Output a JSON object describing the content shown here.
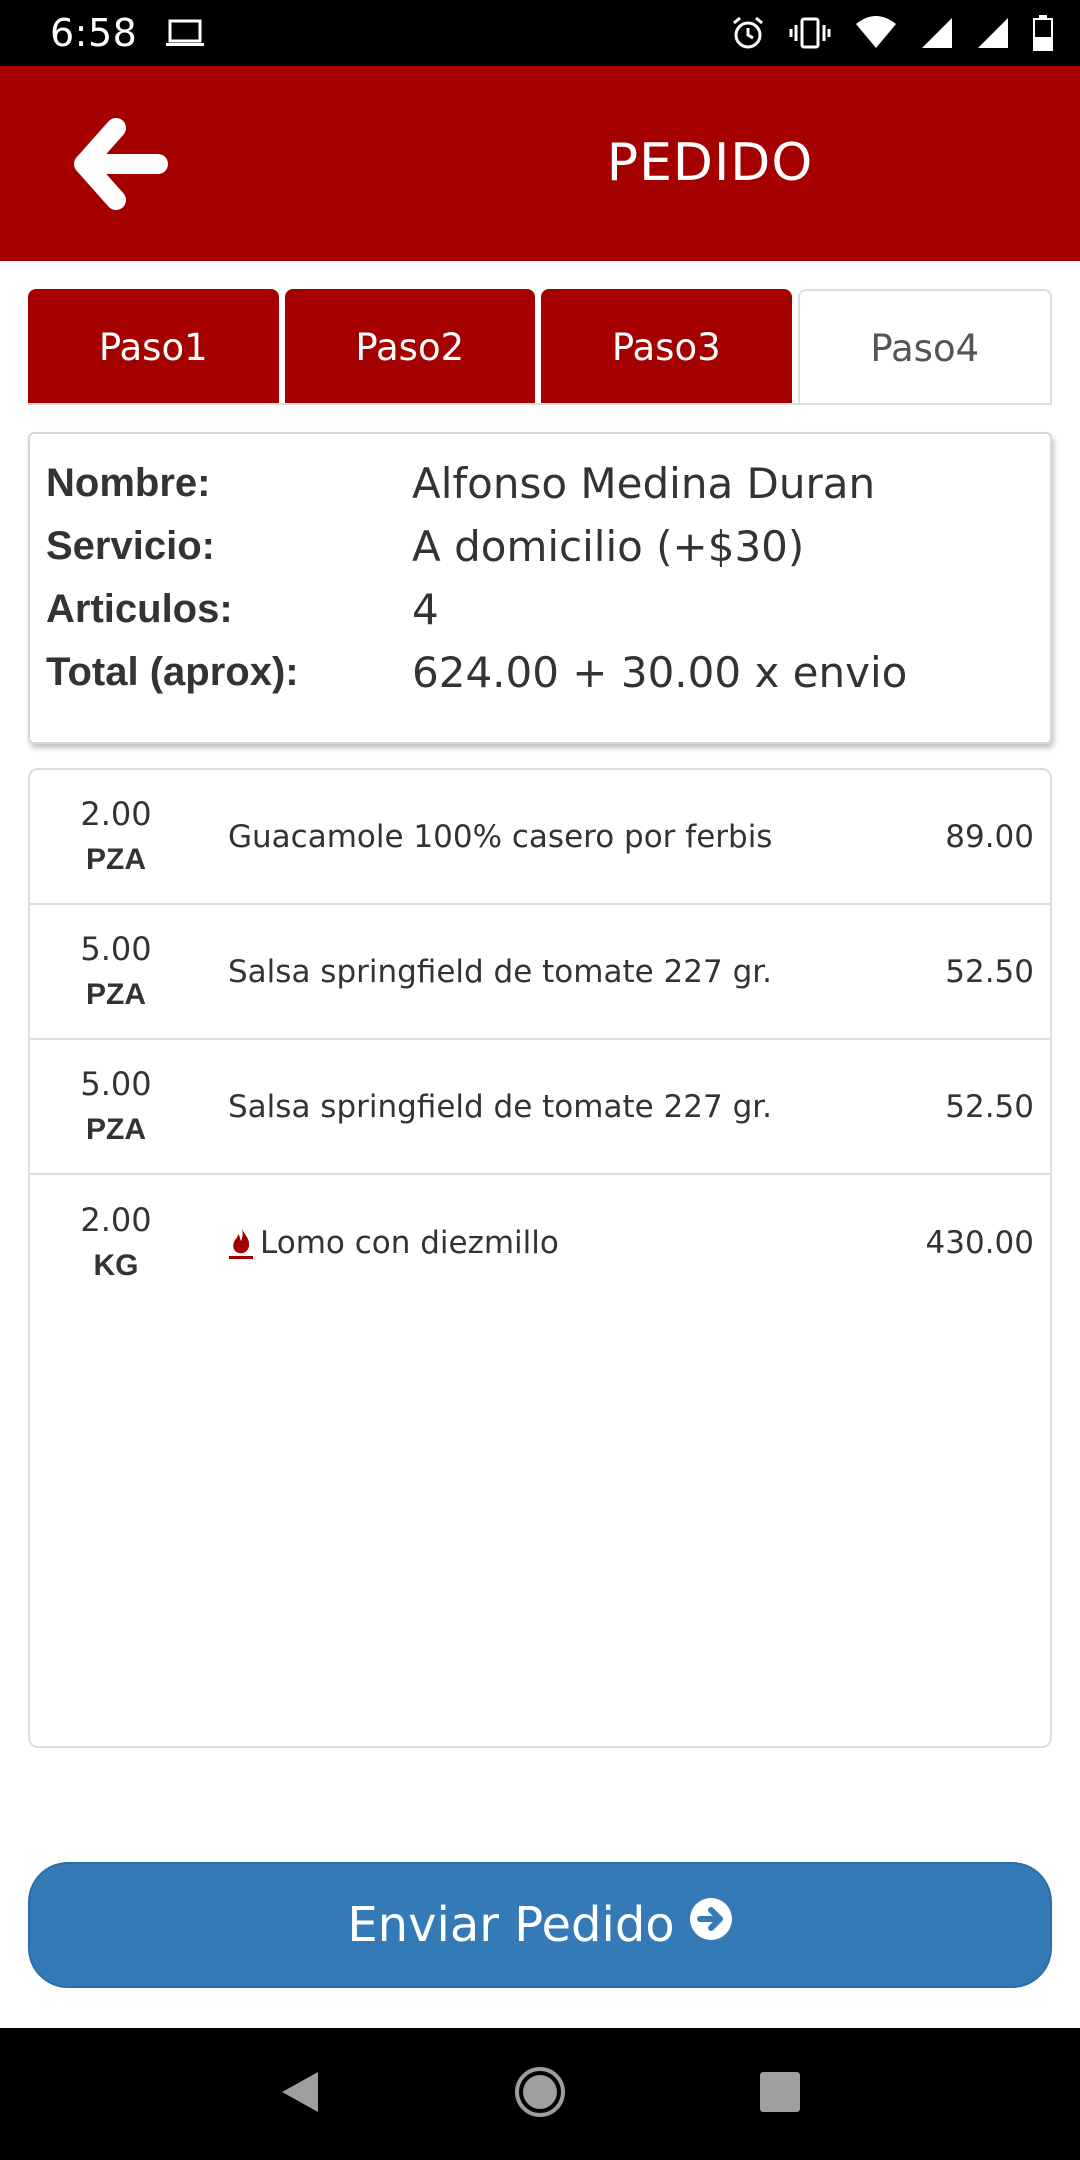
{
  "status_bar": {
    "time": "6:58",
    "icons": [
      "laptop-icon",
      "alarm-icon",
      "vibrate-icon",
      "wifi-icon",
      "signal-icon",
      "signal-icon",
      "battery-icon"
    ]
  },
  "app_bar": {
    "title": "PEDIDO",
    "back_icon": "arrow-left-icon"
  },
  "tabs": [
    {
      "label": "Paso1",
      "state": "done"
    },
    {
      "label": "Paso2",
      "state": "done"
    },
    {
      "label": "Paso3",
      "state": "done"
    },
    {
      "label": "Paso4",
      "state": "active"
    }
  ],
  "summary": {
    "rows": [
      {
        "label": "Nombre:",
        "value": "Alfonso Medina Duran"
      },
      {
        "label": "Servicio:",
        "value": "A domicilio (+$30)"
      },
      {
        "label": "Articulos:",
        "value": "4"
      },
      {
        "label": "Total (aprox):",
        "value": "624.00 + 30.00 x envio"
      }
    ]
  },
  "items": [
    {
      "qty": "2.00",
      "unit": "PZA",
      "description": "Guacamole 100% casero por ferbis",
      "price": "89.00",
      "icon": ""
    },
    {
      "qty": "5.00",
      "unit": "PZA",
      "description": "Salsa springfield de tomate 227 gr.",
      "price": "52.50",
      "icon": ""
    },
    {
      "qty": "5.00",
      "unit": "PZA",
      "description": "Salsa springfield de tomate 227 gr.",
      "price": "52.50",
      "icon": ""
    },
    {
      "qty": "2.00",
      "unit": "KG",
      "description": "Lomo con diezmillo",
      "price": "430.00",
      "icon": "fire-icon"
    }
  ],
  "send_button": {
    "label": "Enviar Pedido",
    "icon": "arrow-circle-right-icon"
  },
  "nav_bar": {
    "buttons": [
      "back-triangle-icon",
      "home-circle-icon",
      "recents-square-icon"
    ]
  },
  "colors": {
    "brand_red": "#a50000",
    "primary_blue": "#337ab7"
  }
}
